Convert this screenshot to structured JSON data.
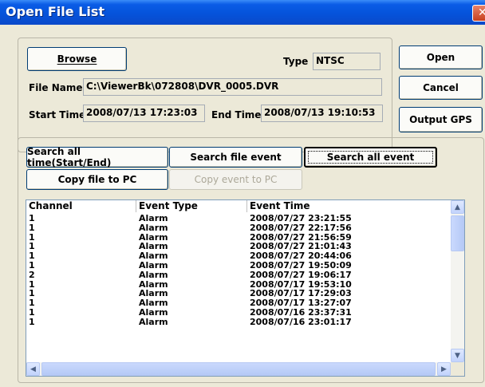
{
  "window": {
    "title": "Open File List",
    "close_glyph": "✕"
  },
  "file_group": {
    "browse_label": "Browse",
    "type_label": "Type",
    "type_value": "NTSC",
    "file_name_label": "File Name",
    "file_name_value": "C:\\ViewerBk\\072808\\DVR_0005.DVR",
    "start_time_label": "Start Time",
    "start_time_value": "2008/07/13 17:23:03",
    "end_time_label": "End Time",
    "end_time_value": "2008/07/13 19:10:53"
  },
  "side_buttons": {
    "open": "Open",
    "cancel": "Cancel",
    "output_gps": "Output GPS"
  },
  "search_buttons": {
    "search_all_time": "Search all time(Start/End)",
    "search_file_event": "Search file event",
    "search_all_event": "Search all event",
    "copy_file": "Copy file to PC",
    "copy_event": "Copy event to PC"
  },
  "list": {
    "columns": [
      "Channel",
      "Event Type",
      "Event Time"
    ],
    "rows": [
      [
        "1",
        "Alarm",
        "2008/07/27 23:21:55"
      ],
      [
        "1",
        "Alarm",
        "2008/07/27 22:17:56"
      ],
      [
        "1",
        "Alarm",
        "2008/07/27 21:56:59"
      ],
      [
        "1",
        "Alarm",
        "2008/07/27 21:01:43"
      ],
      [
        "1",
        "Alarm",
        "2008/07/27 20:44:06"
      ],
      [
        "1",
        "Alarm",
        "2008/07/27 19:50:09"
      ],
      [
        "2",
        "Alarm",
        "2008/07/27 19:06:17"
      ],
      [
        "1",
        "Alarm",
        "2008/07/17 19:53:10"
      ],
      [
        "1",
        "Alarm",
        "2008/07/17 17:29:03"
      ],
      [
        "1",
        "Alarm",
        "2008/07/17 13:27:07"
      ],
      [
        "1",
        "Alarm",
        "2008/07/16 23:37:31"
      ],
      [
        "1",
        "Alarm",
        "2008/07/16 23:01:17"
      ]
    ]
  },
  "colors": {
    "titlebar": "#0553db",
    "dialog_bg": "#ece9d8",
    "list_border": "#7f9db9"
  }
}
